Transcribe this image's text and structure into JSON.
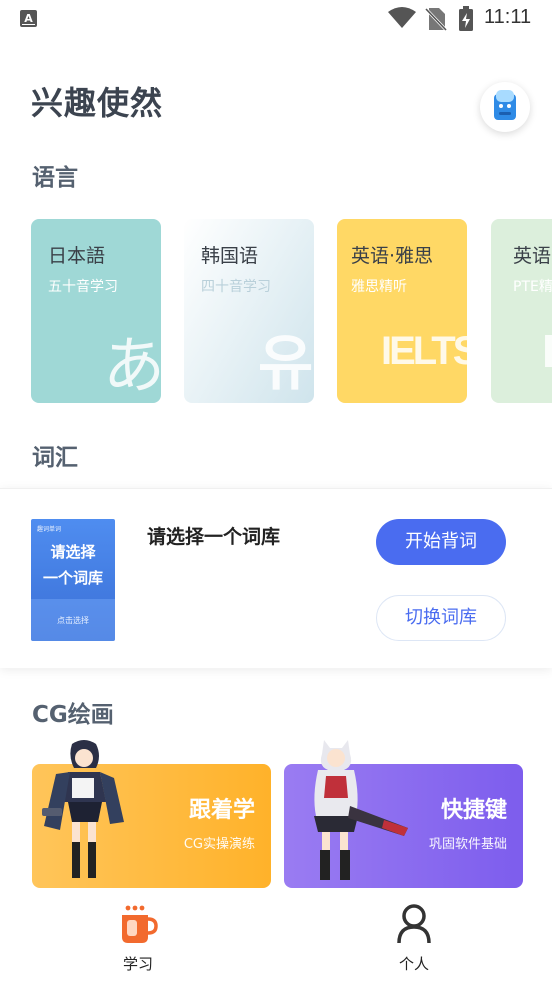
{
  "status_bar": {
    "time": "11:11",
    "notification_icon": "a-icon",
    "wifi_icon": "wifi-icon",
    "sim_icon": "no-sim-icon",
    "battery_icon": "battery-charging-icon"
  },
  "header": {
    "title": "兴趣使然",
    "avatar_icon": "mascot-icon"
  },
  "language": {
    "section_title": "语言",
    "cards": [
      {
        "title": "日本語",
        "subtitle": "五十音学习",
        "big": "あ",
        "color": "#9fd8d6"
      },
      {
        "title": "韩国语",
        "subtitle": "四十音学习",
        "big": "유",
        "color": "#cfe4ec"
      },
      {
        "title": "英语·雅思",
        "subtitle": "雅思精听",
        "big": "IELTS",
        "color": "#ffd865"
      },
      {
        "title": "英语",
        "subtitle": "PTE精",
        "big": "P",
        "color": "#dcefdc"
      }
    ]
  },
  "vocab": {
    "section_title": "词汇",
    "book": {
      "top_text": "趣词单词",
      "line1": "请选择",
      "line2": "一个词库",
      "footer": "点击选择"
    },
    "selected_name": "请选择一个词库",
    "start_button": "开始背词",
    "switch_button": "切换词库"
  },
  "cg": {
    "section_title": "CG绘画",
    "cards": [
      {
        "title": "跟着学",
        "subtitle": "CG实操演练",
        "color": "#ffb52e"
      },
      {
        "title": "快捷键",
        "subtitle": "巩固软件基础",
        "color": "#8b6cf0"
      }
    ]
  },
  "nav": {
    "items": [
      {
        "label": "学习",
        "icon": "coffee-cup-icon",
        "active": true
      },
      {
        "label": "个人",
        "icon": "person-icon",
        "active": false
      }
    ]
  },
  "colors": {
    "accent": "#4a6cf0",
    "active_nav": "#f26a2e",
    "title_text": "#3c4450"
  }
}
